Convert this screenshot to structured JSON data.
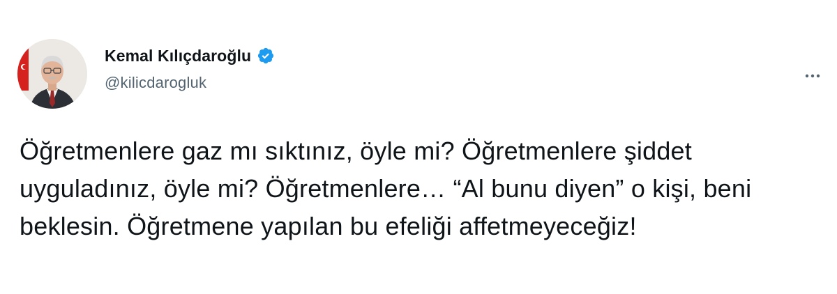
{
  "author": {
    "name": "Kemal Kılıçdaroğlu",
    "handle": "@kilicdarogluk",
    "verified": true
  },
  "icons": {
    "verified": "verified-badge-icon",
    "more": "more-horizontal-icon",
    "avatar": "profile-photo"
  },
  "tweet": {
    "text": "Öğretmenlere gaz mı sıktınız, öyle mi? Öğretmenlere şiddet uyguladınız, öyle mi? Öğretmenlere… “Al bunu diyen” o kişi, beni beklesin. Öğretmene yapılan bu efeliği affetmeyeceğiz!"
  },
  "colors": {
    "text": "#0f1419",
    "secondary": "#536471",
    "verified": "#1d9bf0"
  }
}
